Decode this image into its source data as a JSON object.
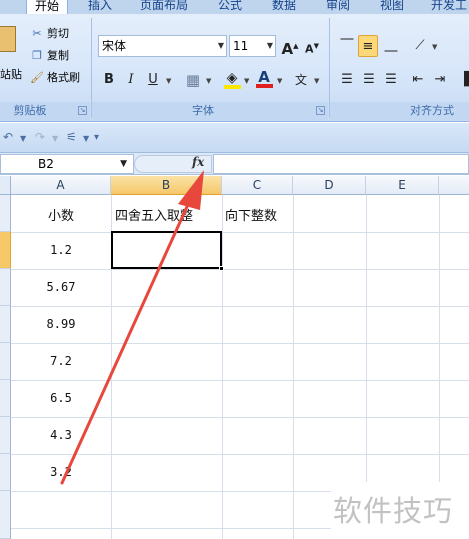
{
  "ribbon_tabs": [
    {
      "label": "开始",
      "active": true
    },
    {
      "label": "插入"
    },
    {
      "label": "页面布局"
    },
    {
      "label": "公式"
    },
    {
      "label": "数据"
    },
    {
      "label": "审阅"
    },
    {
      "label": "视图"
    },
    {
      "label": "开发工"
    }
  ],
  "clipboard": {
    "paste_label": "站贴",
    "cut_label": "剪切",
    "copy_label": "复制",
    "format_painter_label": "格式刷",
    "group_label": "剪贴板"
  },
  "font": {
    "family": "宋体",
    "size": "11",
    "group_label": "字体",
    "grow_label": "A",
    "shrink_label": "A",
    "bold_label": "B",
    "italic_label": "I",
    "underline_label": "U",
    "font_color_label": "A",
    "phonetic_label": "文",
    "font_color_bar": "#e02020",
    "fill_color_bar": "#ffe600"
  },
  "alignment": {
    "group_label": "对齐方式"
  },
  "name_box": "B2",
  "fx_label": "fx",
  "columns": [
    "A",
    "B",
    "C",
    "D",
    "E"
  ],
  "sheet": {
    "headers": {
      "A1": "小数",
      "B1": "四舍五入取整",
      "C1": "向下整数"
    },
    "decimals": [
      "1.2",
      "5.67",
      "8.99",
      "7.2",
      "6.5",
      "4.3",
      "3.2"
    ]
  },
  "colors": {
    "accent_arrow": "#e8473c",
    "selection_header": "#f7c868"
  },
  "watermark": "软件技巧"
}
